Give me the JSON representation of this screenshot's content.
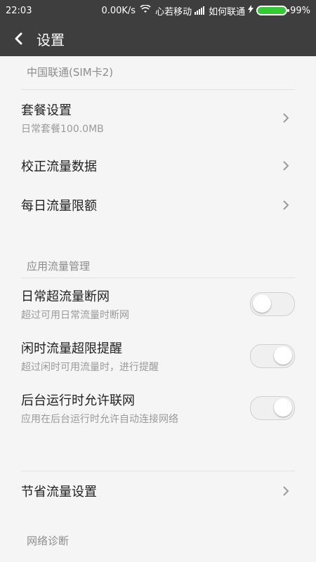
{
  "status_bar": {
    "time": "22:03",
    "net_speed": "0.00K/s",
    "carrier1": "心若移动",
    "carrier2": "如何联通",
    "battery": "99%",
    "battery_level": 0.99,
    "battery_color": "#37c837"
  },
  "app_bar": {
    "title": "设置",
    "back_icon": "chevron-left-icon"
  },
  "sections": {
    "sim": {
      "title": "中国联通(SIM卡2)",
      "items": [
        {
          "title": "套餐设置",
          "subtitle": "日常套餐100.0MB"
        },
        {
          "title": "校正流量数据"
        },
        {
          "title": "每日流量限额"
        }
      ]
    },
    "app_traffic": {
      "title": "应用流量管理",
      "items": [
        {
          "title": "日常超流量断网",
          "subtitle": "超过可用日常流量时断网",
          "toggle": "off"
        },
        {
          "title": "闲时流量超限提醒",
          "subtitle": "超过闲时可用流量时，进行提醒",
          "toggle": "on"
        },
        {
          "title": "后台运行时允许联网",
          "subtitle": "应用在后台运行时允许自动连接网络",
          "toggle": "on"
        }
      ]
    },
    "save": {
      "items": [
        {
          "title": "节省流量设置"
        }
      ]
    },
    "network_diag": {
      "title": "网络诊断"
    }
  }
}
